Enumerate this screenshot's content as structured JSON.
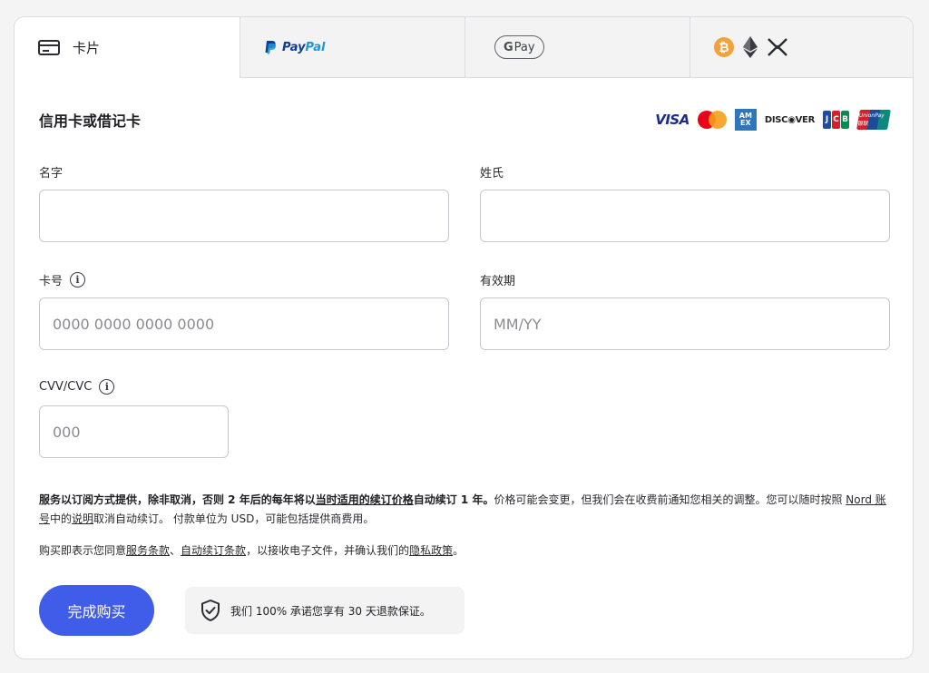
{
  "tabs": {
    "card_label": "卡片",
    "paypal_pay": "Pay",
    "paypal_pal": "Pal",
    "gpay_g": "G",
    "gpay_pay": "Pay"
  },
  "form": {
    "title": "信用卡或借记卡",
    "first_name_label": "名字",
    "last_name_label": "姓氏",
    "card_number_label": "卡号",
    "card_number_placeholder": "0000 0000 0000 0000",
    "expiry_label": "有效期",
    "expiry_placeholder": "MM/YY",
    "cvv_label": "CVV/CVC",
    "cvv_placeholder": "000"
  },
  "brands": {
    "visa": "VISA",
    "amex": "AM EX",
    "discover": "DISC◉VER",
    "jcb": [
      "J",
      "C",
      "B"
    ],
    "unionpay": "UnionPay 银联"
  },
  "terms": {
    "part1": "服务以订阅方式提供，除非取消，否则 2 年后的每年将以",
    "renewal_price_link": "当时适用的续订价格",
    "part2": "自动续订 1 年。",
    "part3": "价格可能会变更，但我们会在收费前通知您相关的调整。您可以随时按照 ",
    "nord_account_link": "Nord 账号",
    "part4": "中的",
    "instructions_link": "说明",
    "part5": "取消自动续订。 付款单位为 USD，可能包括提供商费用。"
  },
  "consent": {
    "part1": "购买即表示您同意",
    "tos_link": "服务条款",
    "sep": "、",
    "auto_renew_link": "自动续订条款",
    "part2": "，以接收电子文件，并确认我们的",
    "privacy_link": "隐私政策",
    "end": "。"
  },
  "actions": {
    "buy_label": "完成购买",
    "guarantee_text": "我们 100% 承诺您享有 30 天退款保证。"
  },
  "colors": {
    "primary": "#3f5de8",
    "bitcoin": "#f2a23b",
    "paypal_dark": "#0f3d91",
    "paypal_light": "#1e95d8"
  }
}
